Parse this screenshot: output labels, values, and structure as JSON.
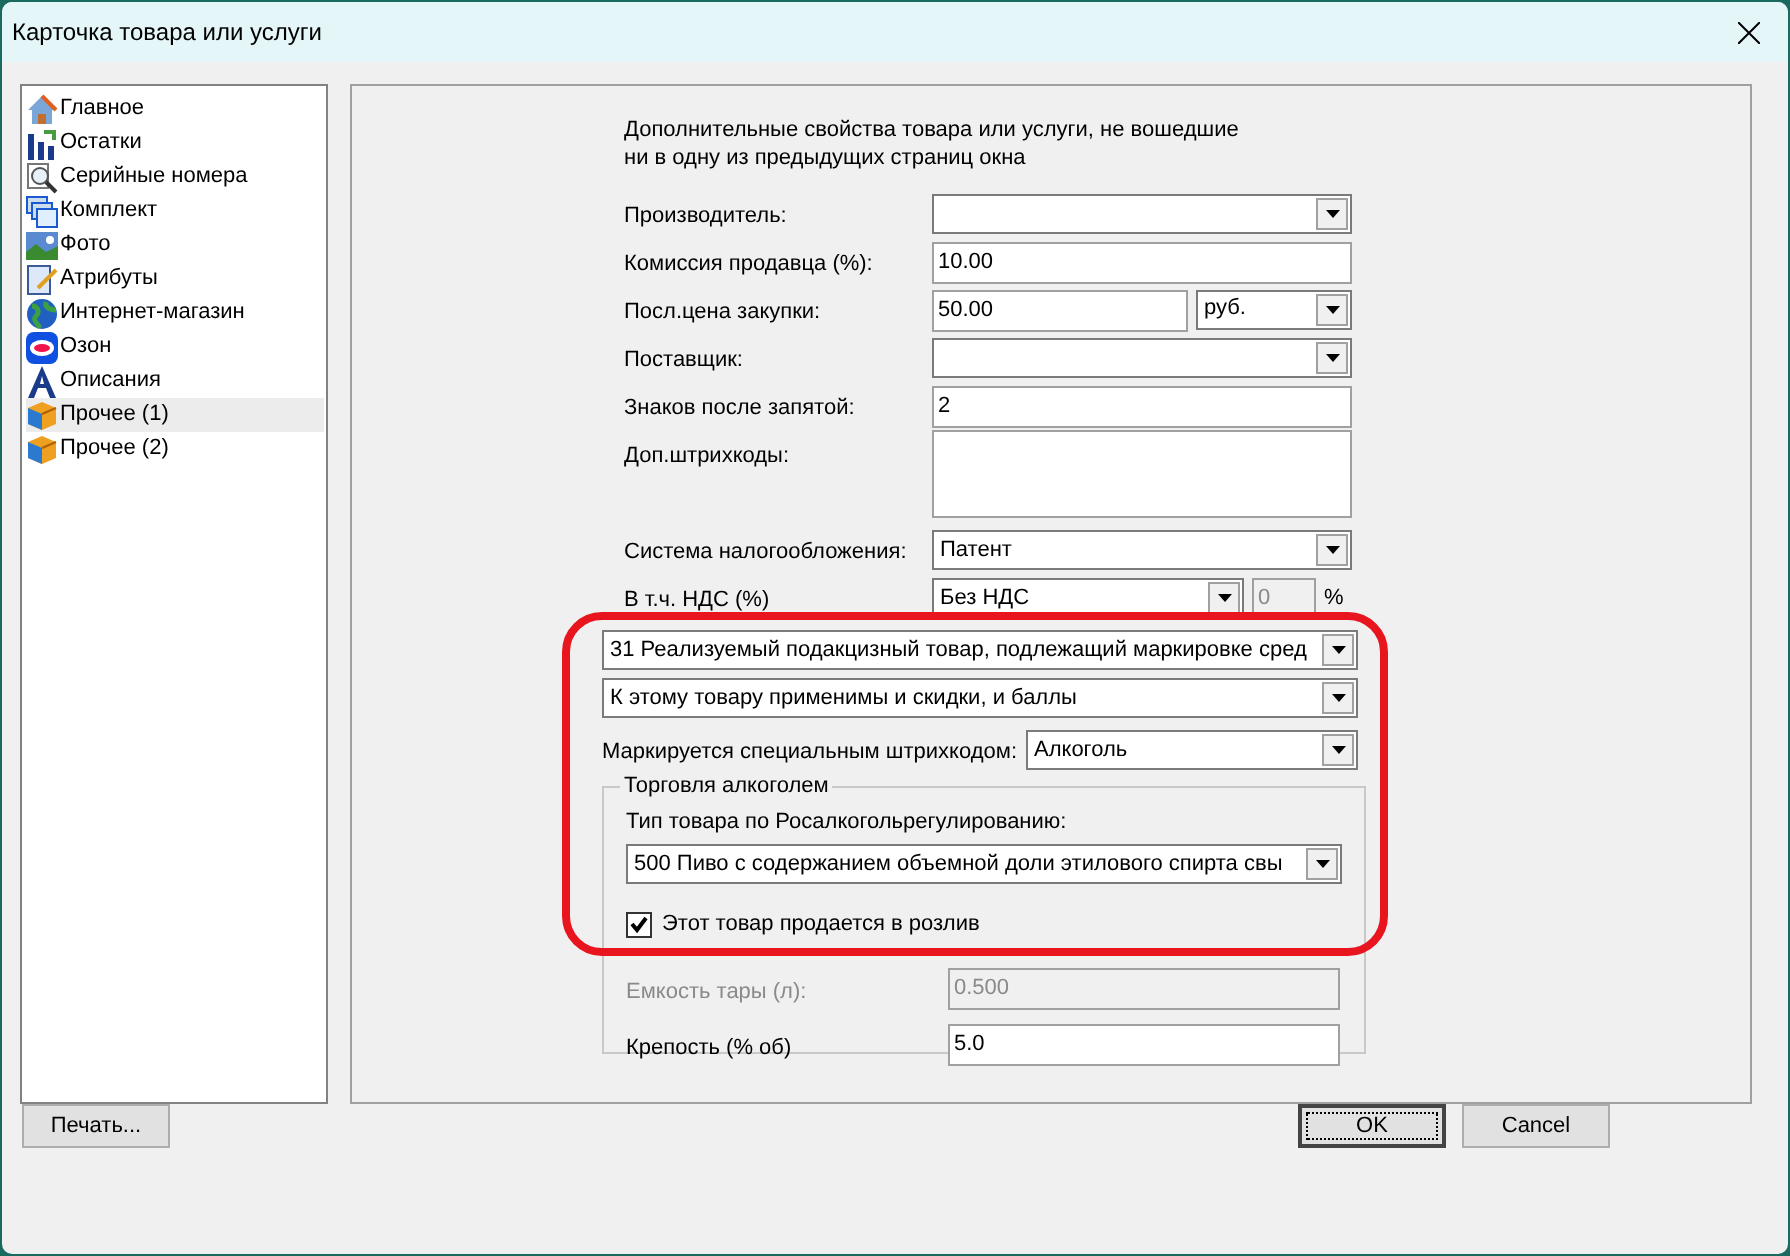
{
  "window": {
    "title": "Карточка товара или услуги"
  },
  "sidebar": {
    "items": [
      {
        "label": "Главное",
        "selected": false
      },
      {
        "label": "Остатки",
        "selected": false
      },
      {
        "label": "Серийные номера",
        "selected": false
      },
      {
        "label": "Комплект",
        "selected": false
      },
      {
        "label": "Фото",
        "selected": false
      },
      {
        "label": "Атрибуты",
        "selected": false
      },
      {
        "label": "Интернет-магазин",
        "selected": false
      },
      {
        "label": "Озон",
        "selected": false
      },
      {
        "label": "Описания",
        "selected": false
      },
      {
        "label": "Прочее (1)",
        "selected": true
      },
      {
        "label": "Прочее (2)",
        "selected": false
      }
    ]
  },
  "page": {
    "description": "Дополнительные свойства товара или услуги, не вошедшие ни в одну из предыдущих страниц окна",
    "fields": [
      {
        "kind": "combo",
        "label": "Производитель:"
      },
      {
        "kind": "text",
        "label": "Комиссия продавца (%):",
        "value": "10.00"
      },
      {
        "kind": "price",
        "label": "Посл.цена закупки:",
        "value": "50.00",
        "unit": "руб."
      },
      {
        "kind": "combo",
        "label": "Поставщик:"
      },
      {
        "kind": "text",
        "label": "Знаков после запятой:",
        "value": "2"
      },
      {
        "kind": "textarea",
        "label": "Доп.штрихкоды:"
      },
      {
        "kind": "combo",
        "label": "Система налогообложения:",
        "value": "Патент"
      },
      {
        "kind": "vat",
        "label": "В т.ч. НДС (%)",
        "value": "Без НДС",
        "rate": "0",
        "suffix": "%"
      }
    ],
    "sign_combo": "31 Реализуемый подакцизный товар, подлежащий маркировке сред",
    "discount_combo": "К этому товару применимы и скидки, и баллы",
    "marking": {
      "label": "Маркируется специальным штрихкодом:",
      "value": "Алкоголь"
    },
    "alcohol": {
      "title": "Торговля алкоголем",
      "type_label": "Тип товара по Росалкогольрегулированию:",
      "type_value": "500  Пиво с содержанием объемной доли этилового спирта свы",
      "draft": {
        "label": "Этот товар продается в розлив",
        "checked": true
      },
      "capacity": {
        "label": "Емкость тары (л):",
        "value": "0.500",
        "disabled": true
      },
      "strength": {
        "label": "Крепость (% об)",
        "value": "5.0",
        "disabled": false
      }
    }
  },
  "buttons": {
    "print": "Печать...",
    "ok": "OK",
    "cancel": "Cancel"
  }
}
